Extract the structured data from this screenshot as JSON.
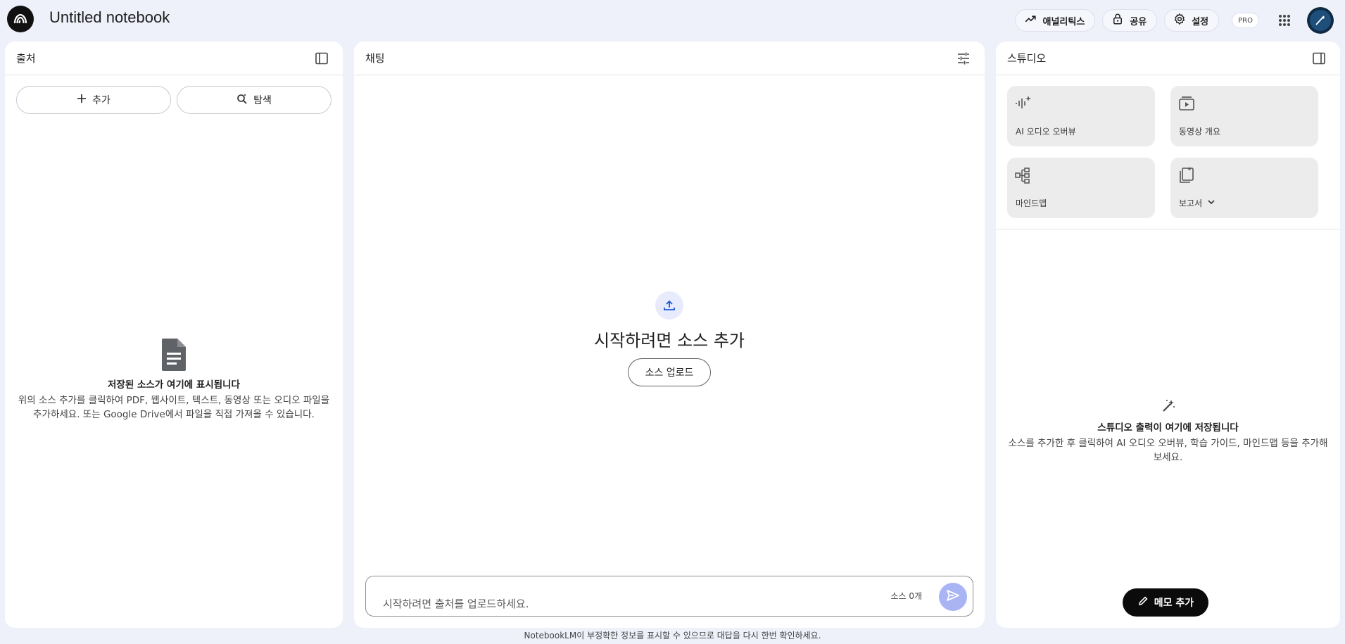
{
  "app": {
    "title": "Untitled notebook"
  },
  "topbar": {
    "analytics_label": "애널리틱스",
    "share_label": "공유",
    "settings_label": "설정",
    "pro_label": "PRO"
  },
  "sources": {
    "title": "출처",
    "add_label": "추가",
    "explore_label": "탐색",
    "empty_title": "저장된 소스가 여기에 표시됩니다",
    "empty_desc": "위의 소스 추가를 클릭하여 PDF, 웹사이트, 텍스트, 동영상 또는 오디오 파일을 추가하세요. 또는 Google Drive에서 파일을 직접 가져올 수 있습니다."
  },
  "chat": {
    "title": "채팅",
    "heading": "시작하려면 소스 추가",
    "upload_label": "소스 업로드",
    "input_placeholder": "시작하려면 출처를 업로드하세요.",
    "source_count": "소스 0개"
  },
  "studio": {
    "title": "스튜디오",
    "cards": [
      {
        "label": "AI 오디오 오버뷰",
        "icon": "audio-waveform-icon"
      },
      {
        "label": "동영상 개요",
        "icon": "video-icon"
      },
      {
        "label": "마인드맵",
        "icon": "mindmap-icon"
      },
      {
        "label": "보고서",
        "icon": "report-icon"
      }
    ],
    "empty_title": "스튜디오 출력이 여기에 저장됩니다",
    "empty_desc": "소스를 추가한 후 클릭하여 AI 오디오 오버뷰, 학습 가이드, 마인드맵 등을 추가해 보세요.",
    "memo_label": "메모 추가"
  },
  "footer": {
    "note": "NotebookLM이 부정확한 정보를 표시할 수 있으므로 대답을 다시 한번 확인하세요."
  },
  "colors": {
    "background": "#eef0fa",
    "accent": "#1a56db",
    "send_button": "#a9b4f4"
  }
}
